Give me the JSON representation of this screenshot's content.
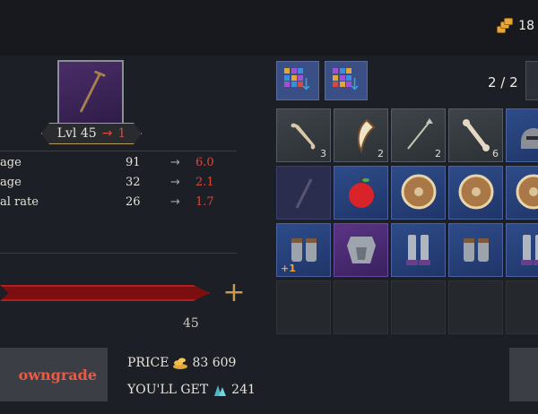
{
  "currency": {
    "amount": "18",
    "icon": "gold-coins-icon"
  },
  "item": {
    "icon": "rusty-nail-icon",
    "level_label": "Lvl 45",
    "level_arrow": "→",
    "level_next": "1"
  },
  "stats": [
    {
      "name": "age",
      "current": "91",
      "arrow": "→",
      "new": "6.0"
    },
    {
      "name": "age",
      "current": "32",
      "arrow": "→",
      "new": "2.1"
    },
    {
      "name": "al rate",
      "current": "26",
      "arrow": "→",
      "new": "1.7"
    }
  ],
  "slider": {
    "max_label": "45",
    "plus_label": "+",
    "fill_fraction": 1.0
  },
  "downgrade_label": "owngrade",
  "price": {
    "label": "PRICE",
    "value": "83 609"
  },
  "you_get": {
    "label": "YOU'LL GET",
    "value": "241"
  },
  "page_indicator": "2 / 2",
  "inventory": {
    "rows": [
      [
        {
          "icon": "bone-club-icon",
          "count": "3",
          "rarity": "grey"
        },
        {
          "icon": "fang-icon",
          "count": "2",
          "rarity": "grey"
        },
        {
          "icon": "arrow-icon",
          "count": "2",
          "rarity": "grey"
        },
        {
          "icon": "bone-icon",
          "count": "6",
          "rarity": "grey"
        },
        {
          "icon": "helmet-icon",
          "count": "",
          "rarity": "blue"
        }
      ],
      [
        {
          "icon": "nail-icon",
          "count": "",
          "rarity": "dim"
        },
        {
          "icon": "apple-icon",
          "count": "",
          "rarity": "blue"
        },
        {
          "icon": "round-shield-icon",
          "count": "",
          "rarity": "blue"
        },
        {
          "icon": "round-shield-icon",
          "count": "",
          "rarity": "blue"
        },
        {
          "icon": "round-shield-icon",
          "count": "",
          "rarity": "blue"
        }
      ],
      [
        {
          "icon": "gauntlets-icon",
          "count": "",
          "bonus": "+1",
          "rarity": "blue"
        },
        {
          "icon": "chest-armor-icon",
          "count": "",
          "rarity": "purple"
        },
        {
          "icon": "greaves-icon",
          "count": "",
          "rarity": "blue"
        },
        {
          "icon": "gauntlets-icon",
          "count": "",
          "rarity": "blue"
        },
        {
          "icon": "greaves-icon",
          "count": "",
          "rarity": "blue"
        }
      ]
    ]
  }
}
